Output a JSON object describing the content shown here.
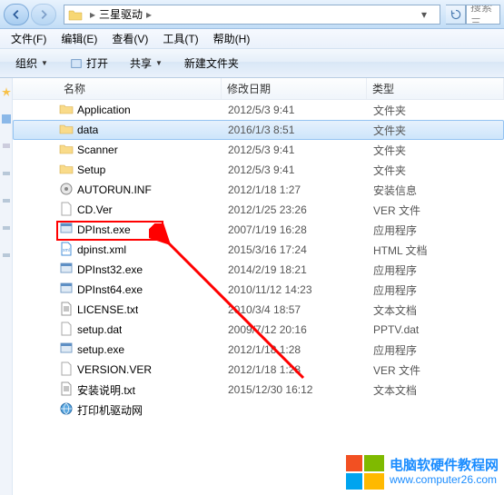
{
  "titlebar": {
    "path_segment": "三星驱动",
    "search_placeholder": "搜索 三"
  },
  "menu": {
    "file": "文件(F)",
    "edit": "编辑(E)",
    "view": "查看(V)",
    "tools": "工具(T)",
    "help": "帮助(H)"
  },
  "toolbar": {
    "organize": "组织",
    "open": "打开",
    "share": "共享",
    "new_folder": "新建文件夹"
  },
  "columns": {
    "name": "名称",
    "date": "修改日期",
    "type": "类型"
  },
  "files": [
    {
      "icon": "folder",
      "name": "Application",
      "date": "2012/5/3 9:41",
      "type": "文件夹",
      "selected": false
    },
    {
      "icon": "folder",
      "name": "data",
      "date": "2016/1/3 8:51",
      "type": "文件夹",
      "selected": true
    },
    {
      "icon": "folder",
      "name": "Scanner",
      "date": "2012/5/3 9:41",
      "type": "文件夹",
      "selected": false
    },
    {
      "icon": "folder",
      "name": "Setup",
      "date": "2012/5/3 9:41",
      "type": "文件夹",
      "selected": false
    },
    {
      "icon": "inf",
      "name": "AUTORUN.INF",
      "date": "2012/1/18 1:27",
      "type": "安装信息",
      "selected": false
    },
    {
      "icon": "file",
      "name": "CD.Ver",
      "date": "2012/1/25 23:26",
      "type": "VER 文件",
      "selected": false
    },
    {
      "icon": "exe",
      "name": "DPInst.exe",
      "date": "2007/1/19 16:28",
      "type": "应用程序",
      "selected": false,
      "highlighted": true
    },
    {
      "icon": "html",
      "name": "dpinst.xml",
      "date": "2015/3/16 17:24",
      "type": "HTML 文档",
      "selected": false
    },
    {
      "icon": "exe",
      "name": "DPInst32.exe",
      "date": "2014/2/19 18:21",
      "type": "应用程序",
      "selected": false
    },
    {
      "icon": "exe",
      "name": "DPInst64.exe",
      "date": "2010/11/12 14:23",
      "type": "应用程序",
      "selected": false
    },
    {
      "icon": "txt",
      "name": "LICENSE.txt",
      "date": "2010/3/4 18:57",
      "type": "文本文档",
      "selected": false
    },
    {
      "icon": "file",
      "name": "setup.dat",
      "date": "2009/7/12 20:16",
      "type": "PPTV.dat",
      "selected": false
    },
    {
      "icon": "exe",
      "name": "setup.exe",
      "date": "2012/1/18 1:28",
      "type": "应用程序",
      "selected": false
    },
    {
      "icon": "file",
      "name": "VERSION.VER",
      "date": "2012/1/18 1:28",
      "type": "VER 文件",
      "selected": false
    },
    {
      "icon": "txt",
      "name": "安装说明.txt",
      "date": "2015/12/30 16:12",
      "type": "文本文档",
      "selected": false
    },
    {
      "icon": "url",
      "name": "打印机驱动网",
      "date": "",
      "type": "",
      "selected": false
    }
  ],
  "watermark": {
    "title": "电脑软硬件教程网",
    "url": "www.computer26.com"
  }
}
